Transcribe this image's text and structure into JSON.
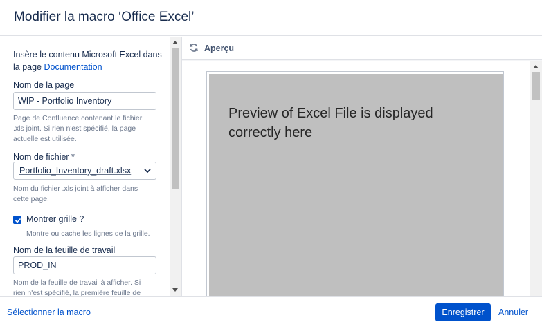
{
  "dialog": {
    "title": "Modifier la macro ‘Office Excel’"
  },
  "form": {
    "intro_text": "Insère le contenu Microsoft Excel dans la page",
    "doc_link": "Documentation",
    "page_name": {
      "label": "Nom de la page",
      "value": "WIP - Portfolio Inventory",
      "help": "Page de Confluence contenant le fichier .xls joint. Si rien n'est spécifié, la page actuelle est utilisée."
    },
    "file_name": {
      "label": "Nom de fichier *",
      "value": "Portfolio_Inventory_draft.xlsx",
      "help": "Nom du fichier .xls joint à afficher dans cette page."
    },
    "show_grid": {
      "label": "Montrer grille ?",
      "checked": true,
      "help": "Montre ou cache les lignes de la grille."
    },
    "worksheet": {
      "label": "Nom de la feuille de travail",
      "value": "PROD_IN",
      "help": "Nom de la feuille de travail à afficher. Si rien n'est spécifié, la première feuille de"
    }
  },
  "preview": {
    "header": "Aperçu",
    "text": "Preview of Excel File is displayed correctly here"
  },
  "footer": {
    "select_macro": "Sélectionner la macro",
    "save": "Enregistrer",
    "cancel": "Annuler"
  },
  "colors": {
    "accent": "#0052cc",
    "preview_bg": "#bfbfbf"
  }
}
